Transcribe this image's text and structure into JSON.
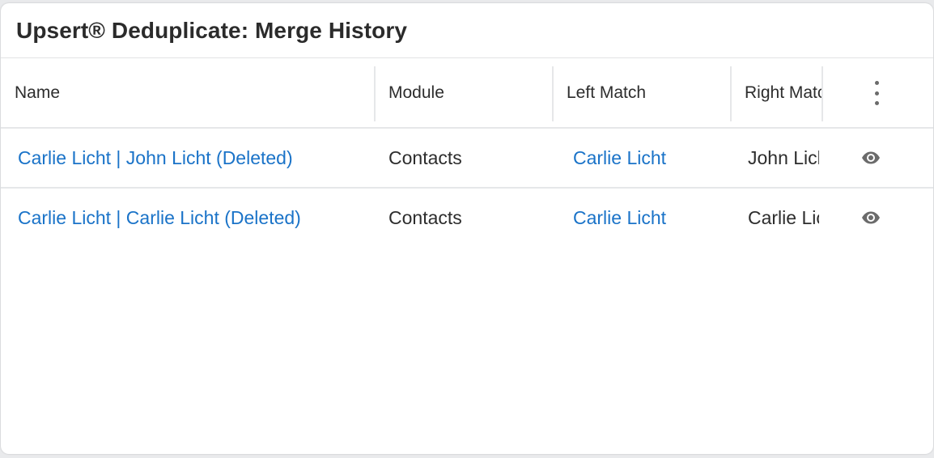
{
  "panel": {
    "title": "Upsert® Deduplicate: Merge History"
  },
  "table": {
    "columns": {
      "name": "Name",
      "module": "Module",
      "left_match": "Left Match",
      "right_match": "Right Match"
    },
    "rows": [
      {
        "name": "Carlie Licht | John Licht (Deleted)",
        "module": "Contacts",
        "left_match": "Carlie Licht",
        "right_match": "John Licht"
      },
      {
        "name": "Carlie Licht | Carlie Licht (Deleted)",
        "module": "Contacts",
        "left_match": "Carlie Licht",
        "right_match": "Carlie Licht"
      }
    ]
  },
  "icons": {
    "column_menu": "kebab-menu-icon",
    "row_action": "eye-icon"
  },
  "colors": {
    "link": "#1a73c8",
    "text": "#2d2d2d",
    "icon": "#6b6b6b",
    "divider": "#e6e7e9"
  }
}
